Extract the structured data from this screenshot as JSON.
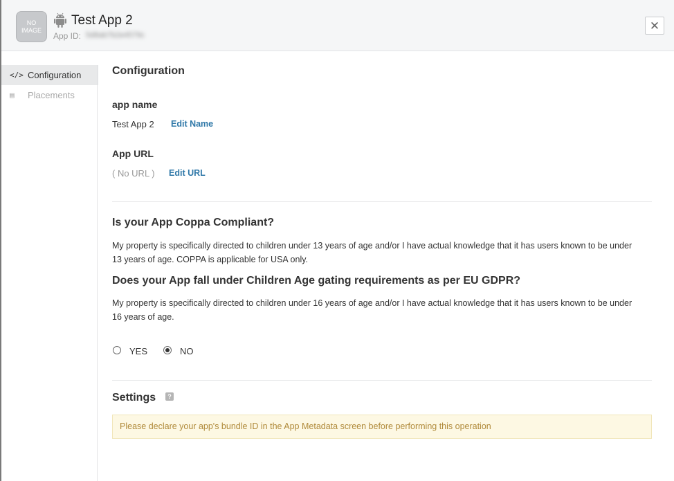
{
  "header": {
    "app_image_text": "NO IMAGE",
    "platform_icon": "android-icon",
    "app_title": "Test App 2",
    "app_id_label": "App ID:",
    "app_id_value": "5d8ab7b2e4579c",
    "close_icon": "close-icon",
    "close_glyph": "✕"
  },
  "sidebar": {
    "items": [
      {
        "icon": "code-icon",
        "glyph": "</>",
        "label": "Configuration",
        "active": true
      },
      {
        "icon": "placements-icon",
        "glyph": "▤",
        "label": "Placements",
        "active": false
      }
    ]
  },
  "main": {
    "title": "Configuration",
    "app_name": {
      "label": "app name",
      "value": "Test App 2",
      "edit_link": "Edit Name"
    },
    "app_url": {
      "label": "App URL",
      "value": "( No URL )",
      "edit_link": "Edit URL"
    },
    "coppa": {
      "question": "Is your App Coppa Compliant?",
      "text": "My property is specifically directed to children under 13 years of age and/or I have actual knowledge that it has users known to be under 13 years of age. COPPA is applicable for USA only."
    },
    "gdpr": {
      "question": "Does your App fall under Children Age gating requirements as per EU GDPR?",
      "text": "My property is specifically directed to children under 16 years of age and/or I have actual knowledge that it has users known to be under 16 years of age.",
      "options": [
        {
          "label": "YES",
          "selected": false
        },
        {
          "label": "NO",
          "selected": true
        }
      ]
    },
    "settings": {
      "title": "Settings",
      "help_glyph": "?",
      "alert": "Please declare your app's bundle ID in the App Metadata screen before performing this operation"
    }
  },
  "colors": {
    "link": "#2f78a8",
    "alert_bg": "#fdf8e3",
    "alert_text": "#b08a3a"
  }
}
